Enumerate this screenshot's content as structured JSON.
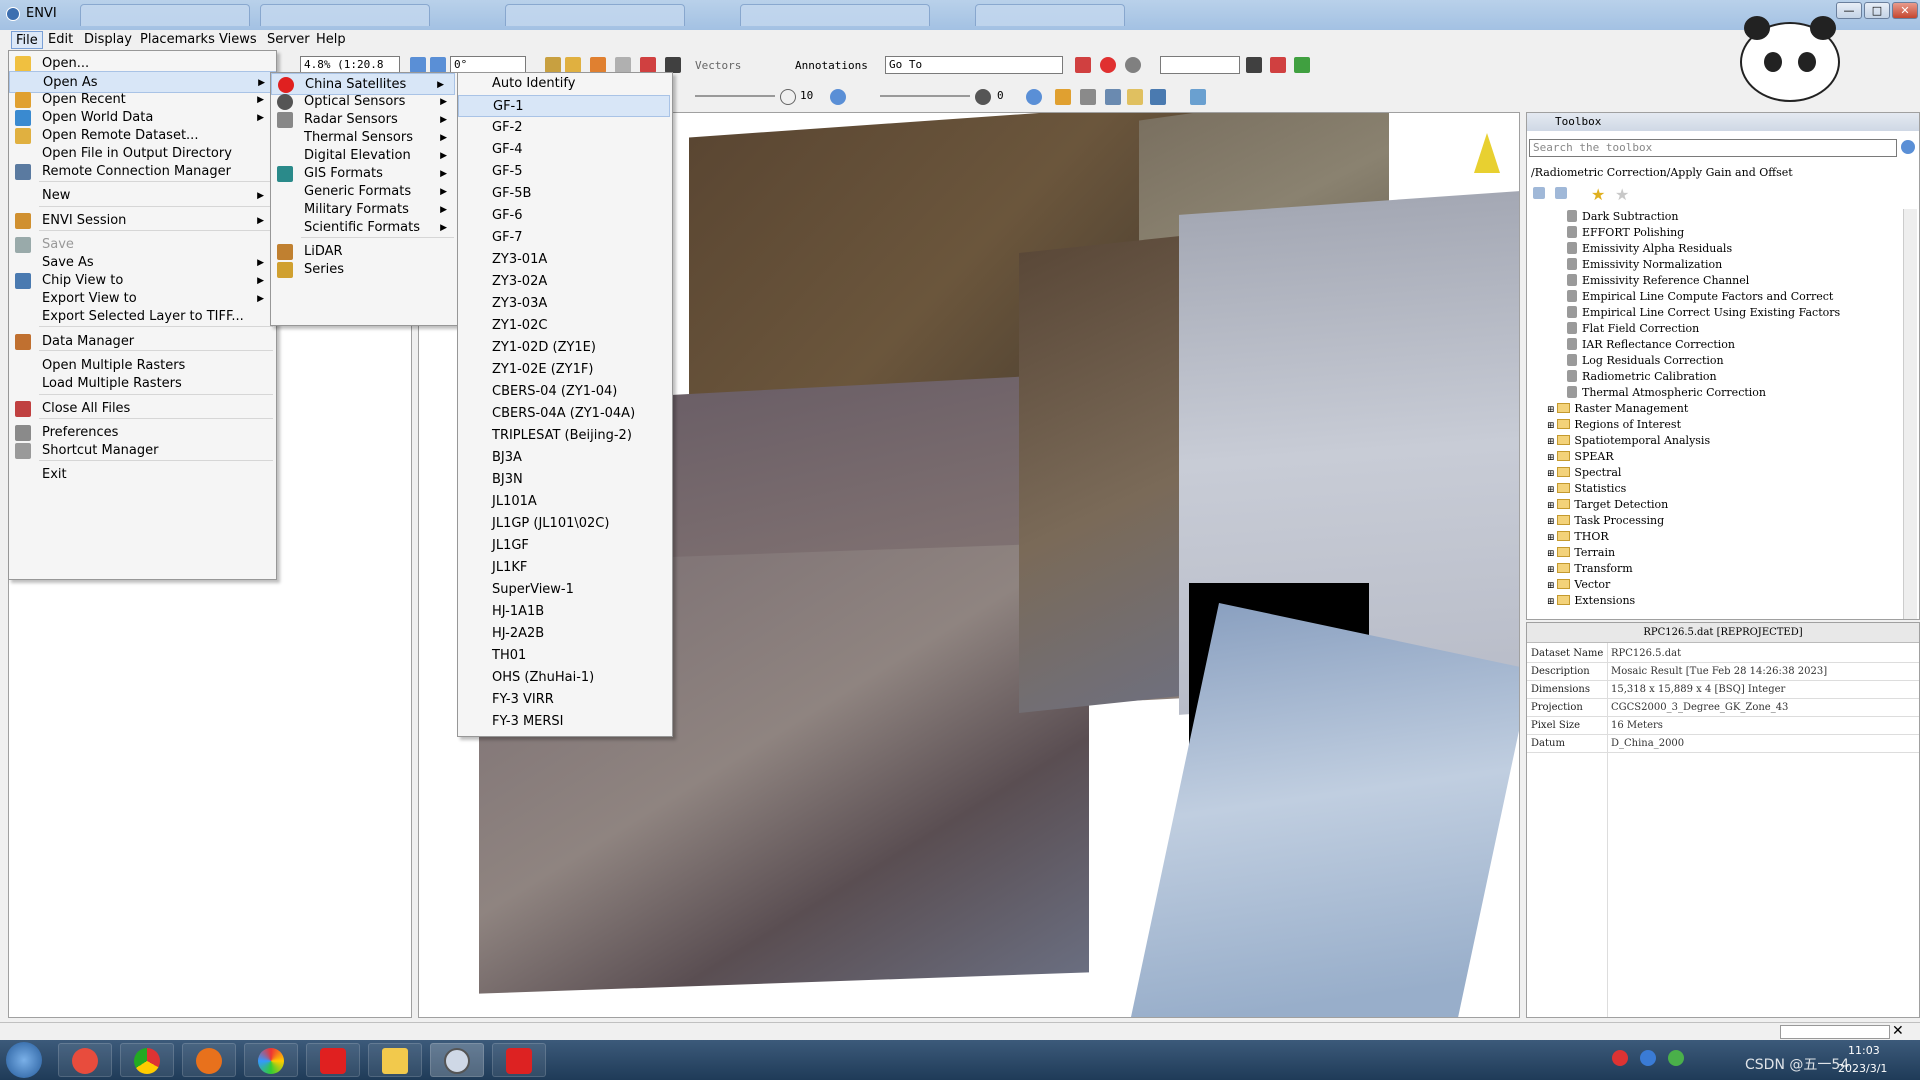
{
  "app": {
    "title": "ENVI",
    "window_buttons": [
      "—",
      "□",
      "✕"
    ]
  },
  "menubar": [
    "File",
    "Edit",
    "Display",
    "Placemarks",
    "Views",
    "Server",
    "Help"
  ],
  "toolbar": {
    "zoom": "4.8% (1:20.8",
    "rotation": "0°",
    "vectors_label": "Vectors",
    "annotations_label": "Annotations",
    "goto_label": "Go To",
    "stretch_value": "10",
    "sharpen_value": "0"
  },
  "file_menu": [
    {
      "label": "Open...",
      "icon": "folder-open-icon"
    },
    {
      "label": "Open As",
      "arrow": true
    },
    {
      "label": "Open Recent",
      "arrow": true,
      "icon": "recent-icon"
    },
    {
      "label": "Open World Data",
      "arrow": true,
      "icon": "globe-icon"
    },
    {
      "label": "Open Remote Dataset...",
      "icon": "remote-folder-icon"
    },
    {
      "label": "Open File in Output Directory"
    },
    {
      "label": "Remote Connection Manager",
      "icon": "connection-icon"
    },
    {
      "label": "New",
      "arrow": true
    },
    {
      "label": "ENVI Session",
      "arrow": true,
      "icon": "session-icon"
    },
    {
      "label": "Save",
      "disabled": true,
      "icon": "save-icon"
    },
    {
      "label": "Save As",
      "arrow": true
    },
    {
      "label": "Chip View to",
      "arrow": true,
      "icon": "chip-icon"
    },
    {
      "label": "Export View to",
      "arrow": true
    },
    {
      "label": "Export Selected Layer to TIFF..."
    },
    {
      "label": "Data Manager",
      "icon": "data-manager-icon"
    },
    {
      "label": "Open Multiple Rasters"
    },
    {
      "label": "Load Multiple Rasters"
    },
    {
      "label": "Close All Files",
      "icon": "close-files-icon"
    },
    {
      "label": "Preferences",
      "icon": "wrench-icon"
    },
    {
      "label": "Shortcut Manager",
      "icon": "keyboard-icon"
    },
    {
      "label": "Exit"
    }
  ],
  "open_as_menu": [
    {
      "label": "China Satellites",
      "icon": "china-flag-icon"
    },
    {
      "label": "Optical Sensors",
      "icon": "optical-icon"
    },
    {
      "label": "Radar Sensors",
      "icon": "radar-icon"
    },
    {
      "label": "Thermal Sensors"
    },
    {
      "label": "Digital Elevation"
    },
    {
      "label": "GIS Formats",
      "icon": "gis-icon"
    },
    {
      "label": "Generic Formats"
    },
    {
      "label": "Military Formats"
    },
    {
      "label": "Scientific Formats"
    },
    {
      "label": "LiDAR",
      "icon": "lidar-icon",
      "no_arrow": true
    },
    {
      "label": "Series",
      "icon": "series-icon",
      "no_arrow": true
    }
  ],
  "china_satellites_menu": [
    "Auto Identify",
    "GF-1",
    "GF-2",
    "GF-4",
    "GF-5",
    "GF-5B",
    "GF-6",
    "GF-7",
    "ZY3-01A",
    "ZY3-02A",
    "ZY3-03A",
    "ZY1-02C",
    "ZY1-02D (ZY1E)",
    "ZY1-02E (ZY1F)",
    "CBERS-04 (ZY1-04)",
    "CBERS-04A (ZY1-04A)",
    "TRIPLESAT (Beijing-2)",
    "BJ3A",
    "BJ3N",
    "JL101A",
    "JL1GP (JL101\\02C)",
    "JL1GF",
    "JL1KF",
    "SuperView-1",
    "HJ-1A1B",
    "HJ-2A2B",
    "TH01",
    "OHS (ZhuHai-1)",
    "FY-3 VIRR",
    "FY-3 MERSI"
  ],
  "toolbox": {
    "title": "Toolbox",
    "search_placeholder": "Search the toolbox",
    "path": "/Radiometric Correction/Apply Gain and Offset",
    "tools": [
      "Dark Subtraction",
      "EFFORT Polishing",
      "Emissivity Alpha Residuals",
      "Emissivity Normalization",
      "Emissivity Reference Channel",
      "Empirical Line Compute Factors and Correct",
      "Empirical Line Correct Using Existing Factors",
      "Flat Field Correction",
      "IAR Reflectance Correction",
      "Log Residuals Correction",
      "Radiometric Calibration",
      "Thermal Atmospheric Correction"
    ],
    "folders": [
      "Raster Management",
      "Regions of Interest",
      "Spatiotemporal Analysis",
      "SPEAR",
      "Spectral",
      "Statistics",
      "Target Detection",
      "Task Processing",
      "THOR",
      "Terrain",
      "Transform",
      "Vector",
      "Extensions"
    ]
  },
  "metadata": {
    "title": "RPC126.5.dat [REPROJECTED]",
    "rows": [
      {
        "key": "Dataset Name",
        "value": "RPC126.5.dat"
      },
      {
        "key": "Description",
        "value": "Mosaic Result [Tue Feb 28 14:26:38 2023]"
      },
      {
        "key": "Dimensions",
        "value": "15,318 x 15,889 x 4 [BSQ] Integer"
      },
      {
        "key": "Projection",
        "value": "CGCS2000_3_Degree_GK_Zone_43"
      },
      {
        "key": "Pixel Size",
        "value": "16 Meters"
      },
      {
        "key": "Datum",
        "value": "D_China_2000"
      }
    ]
  },
  "taskbar": {
    "time": "11:03",
    "date": "2023/3/1",
    "watermark": "CSDN @五一54"
  },
  "colors": {
    "highlight": "#d8e6f7",
    "menu_bg": "#f5f5f5",
    "taskbar": "#1f3b58"
  }
}
